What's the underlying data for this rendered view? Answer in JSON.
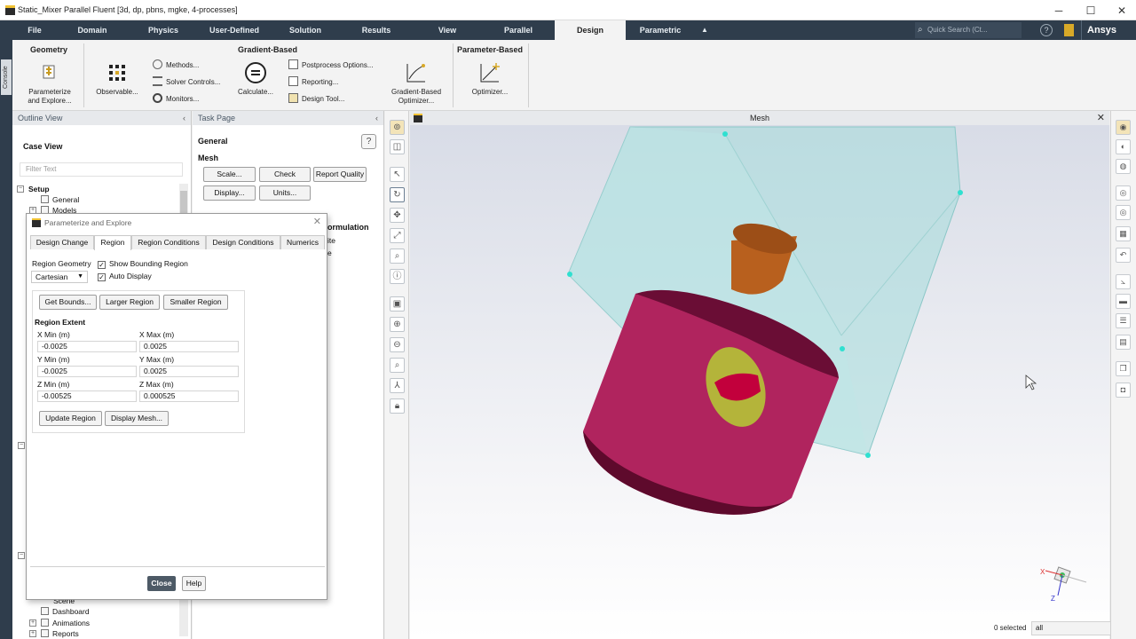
{
  "window": {
    "title": "Static_Mixer Parallel Fluent  [3d, dp, pbns, mgke, 4-processes]",
    "minimize": "─",
    "maximize": "☐",
    "close": "✕"
  },
  "menu": {
    "tabs": [
      "File",
      "Domain",
      "Physics",
      "User-Defined",
      "Solution",
      "Results",
      "View",
      "Parallel",
      "Design",
      "Parametric"
    ],
    "active_tab": "Design",
    "collapse_glyph": "▲",
    "search_placeholder": "Quick Search (Ct...",
    "help_glyph": "?",
    "brand": "Ansys"
  },
  "console_strip": {
    "label": "Console"
  },
  "ribbon": {
    "geometry": {
      "title": "Geometry",
      "parameterize_line1": "Parameterize",
      "parameterize_line2": "and Explore..."
    },
    "gradient_based": {
      "title": "Gradient-Based",
      "observable": "Observable...",
      "methods": "Methods...",
      "solver_controls": "Solver Controls...",
      "monitors": "Monitors...",
      "calculate": "Calculate...",
      "postprocess_options": "Postprocess Options...",
      "reporting": "Reporting...",
      "design_tool": "Design Tool...",
      "gb_optimizer_line1": "Gradient-Based",
      "gb_optimizer_line2": "Optimizer..."
    },
    "parameter_based": {
      "title": "Parameter-Based",
      "optimizer": "Optimizer..."
    }
  },
  "outline": {
    "header": "Outline View",
    "collapse": "‹",
    "case_view": "Case View",
    "filter_placeholder": "Filter Text",
    "setup": "Setup",
    "general": "General",
    "models": "Models",
    "scene": "Scene",
    "dashboard": "Dashboard",
    "animations": "Animations",
    "reports": "Reports",
    "expand": "+",
    "collapse_tree": "−"
  },
  "taskpage": {
    "header": "Task Page",
    "collapse": "‹",
    "section_general": "General",
    "section_mesh": "Mesh",
    "help": "?",
    "scale": "Scale...",
    "check": "Check",
    "report_quality": "Report Quality",
    "display": "Display...",
    "units": "Units...",
    "formulation": "ormulation",
    "formulation_opt1": "ite",
    "formulation_opt2": "e"
  },
  "graphics": {
    "title": "Mesh",
    "close": "✕"
  },
  "status": {
    "selected": "0 selected",
    "filter_value": "all",
    "arrow": "⌄"
  },
  "dialog": {
    "title": "Parameterize and Explore",
    "close": "✕",
    "tabs": [
      "Design Change",
      "Region",
      "Region Conditions",
      "Design Conditions",
      "Numerics"
    ],
    "active_tab": "Region",
    "region_geometry_label": "Region Geometry",
    "region_geometry_value": "Cartesian",
    "show_bounding_region": "Show Bounding Region",
    "show_bounding_region_checked": true,
    "auto_display": "Auto Display",
    "auto_display_checked": true,
    "check_glyph": "✓",
    "get_bounds": "Get Bounds...",
    "larger_region": "Larger Region",
    "smaller_region": "Smaller Region",
    "region_extent": "Region Extent",
    "x_min_label": "X Min (m)",
    "x_min": "-0.0025",
    "x_max_label": "X Max (m)",
    "x_max": "0.0025",
    "y_min_label": "Y Min (m)",
    "y_min": "-0.0025",
    "y_max_label": "Y Max (m)",
    "y_max": "0.0025",
    "z_min_label": "Z Min (m)",
    "z_min": "-0.00525",
    "z_max_label": "Z Max (m)",
    "z_max": "0.000525",
    "update_region": "Update Region",
    "display_mesh": "Display Mesh...",
    "close_button": "Close",
    "help_button": "Help"
  },
  "colors": {
    "menubar": "#2f3d4c",
    "bounding_box": "#a9dcdc",
    "cylinder_body": "#b0245e",
    "cylinder_dark": "#5e0a2c",
    "pipe": "#b8601e",
    "hole": "#b4b43a",
    "accent_points": "#2fe0d0"
  }
}
